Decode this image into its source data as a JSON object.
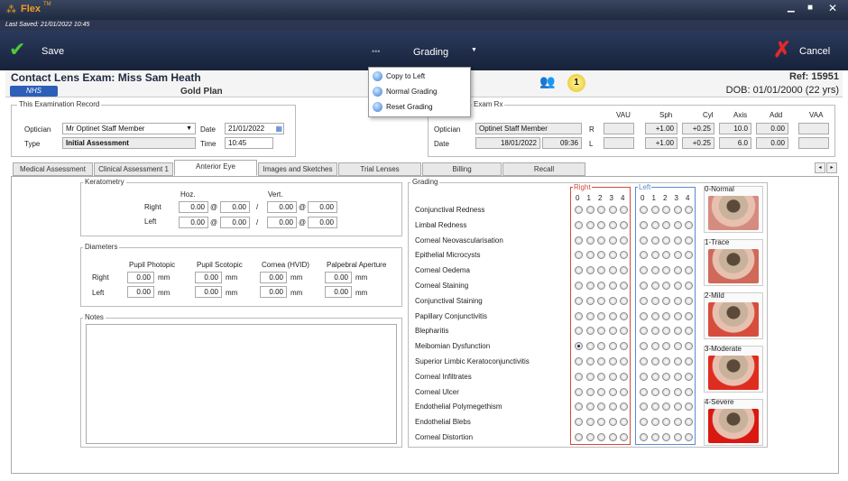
{
  "app": {
    "title": "Flex",
    "tm": "TM",
    "last_saved": "Last Saved: 21/01/2022 10:45"
  },
  "toolbar": {
    "save": "Save",
    "dots": "•••",
    "grading": "Grading",
    "cancel": "Cancel"
  },
  "menu": [
    {
      "label": "Copy to Left"
    },
    {
      "label": "Normal Grading"
    },
    {
      "label": "Reset Grading"
    }
  ],
  "header": {
    "title": "Contact Lens Exam: Miss Sam Heath",
    "nhs": "NHS",
    "plan": "Gold Plan",
    "badge_count": "1",
    "ref": "Ref: 15951",
    "dob": "DOB: 01/01/2000 (22 yrs)"
  },
  "record": {
    "title": "This Examination Record",
    "optician_label": "Optician",
    "optician_value": "Mr Optinet Staff Member",
    "type_label": "Type",
    "type_value": "Initial Assessment",
    "date_label": "Date",
    "date_value": "21/01/2022",
    "time_label": "Time",
    "time_value": "10:45"
  },
  "exam_rx": {
    "title": "Exam Rx",
    "optician_label": "Optician",
    "optician_value": "Optinet Staff Member",
    "date_label": "Date",
    "date_value": "18/01/2022",
    "time_value": "09:36",
    "headers": [
      "VAU",
      "Sph",
      "Cyl",
      "Axis",
      "Add",
      "VAA"
    ],
    "rows": [
      {
        "eye": "R",
        "values": [
          "",
          "+1.00",
          "+0.25",
          "10.0",
          "0.00",
          ""
        ]
      },
      {
        "eye": "L",
        "values": [
          "",
          "+1.00",
          "+0.25",
          "6.0",
          "0.00",
          ""
        ]
      }
    ]
  },
  "tabs": [
    "Medical Assessment",
    "Clinical Assessment 1",
    "Anterior Eye",
    "Images and Sketches",
    "Trial Lenses",
    "Billing",
    "Recall"
  ],
  "keratometry": {
    "title": "Keratometry",
    "hoz": "Hoz.",
    "vert": "Vert.",
    "right_label": "Right",
    "left_label": "Left",
    "at": "@",
    "slash": "/",
    "right": [
      "0.00",
      "0.00",
      "0.00",
      "0.00"
    ],
    "left": [
      "0.00",
      "0.00",
      "0.00",
      "0.00"
    ]
  },
  "diameters": {
    "title": "Diameters",
    "headers": [
      "Pupil Photopic",
      "Pupil Scotopic",
      "Cornea (HVID)",
      "Palpebral Aperture"
    ],
    "right_label": "Right",
    "left_label": "Left",
    "unit": "mm",
    "right": [
      "0.00",
      "0.00",
      "0.00",
      "0.00"
    ],
    "left": [
      "0.00",
      "0.00",
      "0.00",
      "0.00"
    ]
  },
  "notes": {
    "title": "Notes"
  },
  "grading": {
    "title": "Grading",
    "right_label": "Right",
    "left_label": "Left",
    "scale": [
      "0",
      "1",
      "2",
      "3",
      "4"
    ],
    "conditions": [
      "Conjunctival Redness",
      "Limbal Redness",
      "Corneal Neovascularisation",
      "Epithelial Microcysts",
      "Corneal Oedema",
      "Corneal Staining",
      "Conjunctival Staining",
      "Papillary Conjunctivitis",
      "Blepharitis",
      "Meibomian Dysfunction",
      "Superior Limbic Keratoconjunctivitis",
      "Corneal Infiltrates",
      "Corneal Ulcer",
      "Endothelial Polymegethism",
      "Endothelial Blebs",
      "Corneal Distortion"
    ],
    "selected": {
      "row": 9,
      "eye": "right",
      "grade": 0
    },
    "references": [
      "0-Normal",
      "1-Trace",
      "2-Mild",
      "3-Moderate",
      "4-Severe"
    ]
  },
  "colors": {
    "right": "#d04a3a",
    "left": "#5a8ad0",
    "accent": "#f0a020"
  }
}
